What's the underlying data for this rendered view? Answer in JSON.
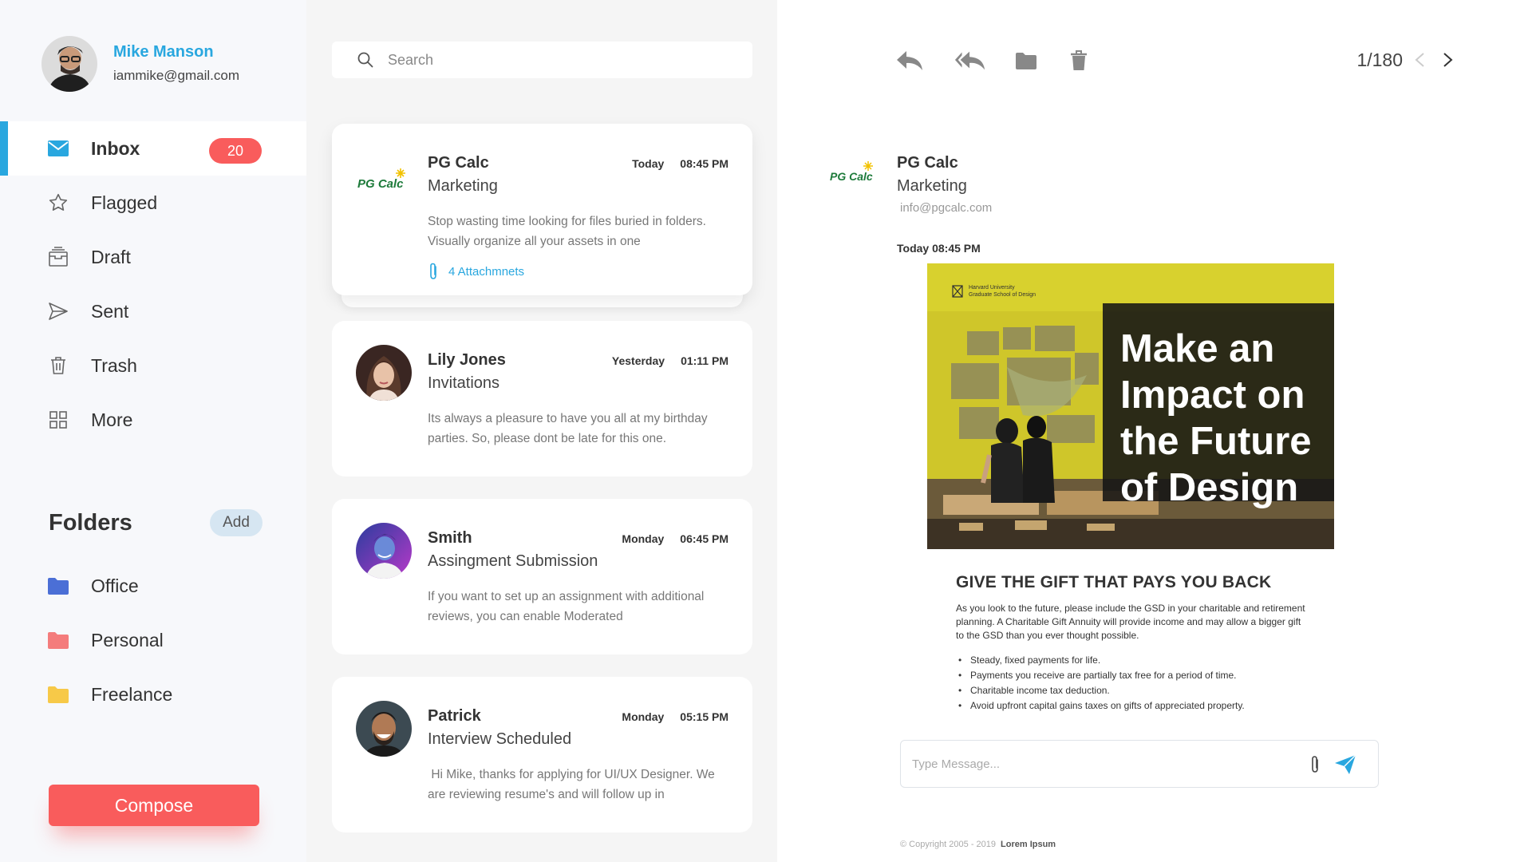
{
  "profile": {
    "name": "Mike Manson",
    "email": "iammike@gmail.com"
  },
  "nav": {
    "items": [
      {
        "label": "Inbox",
        "icon": "mail-icon",
        "badge": "20",
        "active": true
      },
      {
        "label": "Flagged",
        "icon": "star-icon"
      },
      {
        "label": "Draft",
        "icon": "draft-icon"
      },
      {
        "label": "Sent",
        "icon": "send-icon"
      },
      {
        "label": "Trash",
        "icon": "trash-icon"
      },
      {
        "label": "More",
        "icon": "grid-icon"
      }
    ]
  },
  "folders": {
    "title": "Folders",
    "add_label": "Add",
    "items": [
      {
        "label": "Office",
        "color": "#4b6fd6"
      },
      {
        "label": "Personal",
        "color": "#f47c7c"
      },
      {
        "label": "Freelance",
        "color": "#f7c948"
      }
    ]
  },
  "compose_label": "Compose",
  "search": {
    "placeholder": "Search"
  },
  "mails": [
    {
      "sender": "PG Calc",
      "subject": "Marketing",
      "day": "Today",
      "time": "08:45 PM",
      "preview": "Stop wasting time looking for files buried in folders. Visually organize all your assets in one",
      "attachments": "4 Attachmnets",
      "logo": "PG Calc"
    },
    {
      "sender": "Lily Jones",
      "subject": "Invitations",
      "day": "Yesterday",
      "time": "01:11 PM",
      "preview": "Its always a pleasure to have you all at my birthday parties. So, please dont be late for this one."
    },
    {
      "sender": "Smith",
      "subject": "Assingment Submission",
      "day": "Monday",
      "time": "06:45 PM",
      "preview": "If you want to set up an assignment with additional reviews, you can enable Moderated"
    },
    {
      "sender": "Patrick",
      "subject": "Interview Scheduled",
      "day": "Monday",
      "time": "05:15 PM",
      "preview": " Hi Mike, thanks for applying for UI/UX Designer. We are reviewing resume's and will follow up in"
    }
  ],
  "reader": {
    "pager": "1/180",
    "sender": "PG Calc",
    "subject": "Marketing",
    "email": "info@pgcalc.com",
    "timestamp": "Today 08:45 PM",
    "banner": {
      "org_line1": "Harvard University",
      "org_line2": "Graduate School of Design",
      "lines": [
        "Make an",
        "Impact on",
        "the Future",
        "of Design"
      ]
    },
    "heading": "GIVE THE GIFT THAT PAYS YOU BACK",
    "body": "As you look to the future, please include the GSD in your charitable and retirement planning. A Charitable Gift Annuity will provide income and may allow a bigger gift to the GSD than you ever thought possible.",
    "bullets": [
      "Steady, fixed payments for life.",
      "Payments you receive are partially tax free for a period of time.",
      "Charitable income tax deduction.",
      "Avoid upfront capital gains taxes on gifts of appreciated property."
    ],
    "message_placeholder": "Type Message...",
    "footer_copyright": "© Copyright 2005 - 2019",
    "footer_brand": "Lorem Ipsum"
  },
  "colors": {
    "accent": "#29a7df",
    "danger": "#f95c5c",
    "sidebar_bg": "#f7f8fb",
    "list_bg": "#f5f5f5"
  }
}
